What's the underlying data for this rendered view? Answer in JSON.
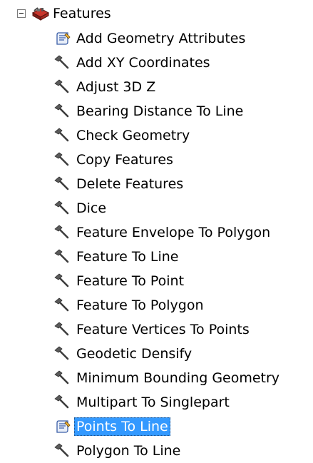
{
  "toolbox": {
    "label": "Features",
    "expanded": true,
    "icon": "toolbox-icon",
    "expander_icon": "collapse-minus-icon"
  },
  "tools": [
    {
      "label": "Add Geometry Attributes",
      "icon": "script-tool-icon",
      "selected": false
    },
    {
      "label": "Add XY Coordinates",
      "icon": "hammer-tool-icon",
      "selected": false
    },
    {
      "label": "Adjust 3D Z",
      "icon": "hammer-tool-icon",
      "selected": false
    },
    {
      "label": "Bearing Distance To Line",
      "icon": "hammer-tool-icon",
      "selected": false
    },
    {
      "label": "Check Geometry",
      "icon": "hammer-tool-icon",
      "selected": false
    },
    {
      "label": "Copy Features",
      "icon": "hammer-tool-icon",
      "selected": false
    },
    {
      "label": "Delete Features",
      "icon": "hammer-tool-icon",
      "selected": false
    },
    {
      "label": "Dice",
      "icon": "hammer-tool-icon",
      "selected": false
    },
    {
      "label": "Feature Envelope To Polygon",
      "icon": "hammer-tool-icon",
      "selected": false
    },
    {
      "label": "Feature To Line",
      "icon": "hammer-tool-icon",
      "selected": false
    },
    {
      "label": "Feature To Point",
      "icon": "hammer-tool-icon",
      "selected": false
    },
    {
      "label": "Feature To Polygon",
      "icon": "hammer-tool-icon",
      "selected": false
    },
    {
      "label": "Feature Vertices To Points",
      "icon": "hammer-tool-icon",
      "selected": false
    },
    {
      "label": "Geodetic Densify",
      "icon": "hammer-tool-icon",
      "selected": false
    },
    {
      "label": "Minimum Bounding Geometry",
      "icon": "hammer-tool-icon",
      "selected": false
    },
    {
      "label": "Multipart To Singlepart",
      "icon": "hammer-tool-icon",
      "selected": false
    },
    {
      "label": "Points To Line",
      "icon": "script-tool-icon",
      "selected": true
    },
    {
      "label": "Polygon To Line",
      "icon": "hammer-tool-icon",
      "selected": false
    }
  ],
  "colors": {
    "selection_background": "#3399ff",
    "selection_text": "#ffffff",
    "text": "#000000",
    "background": "#ffffff"
  }
}
